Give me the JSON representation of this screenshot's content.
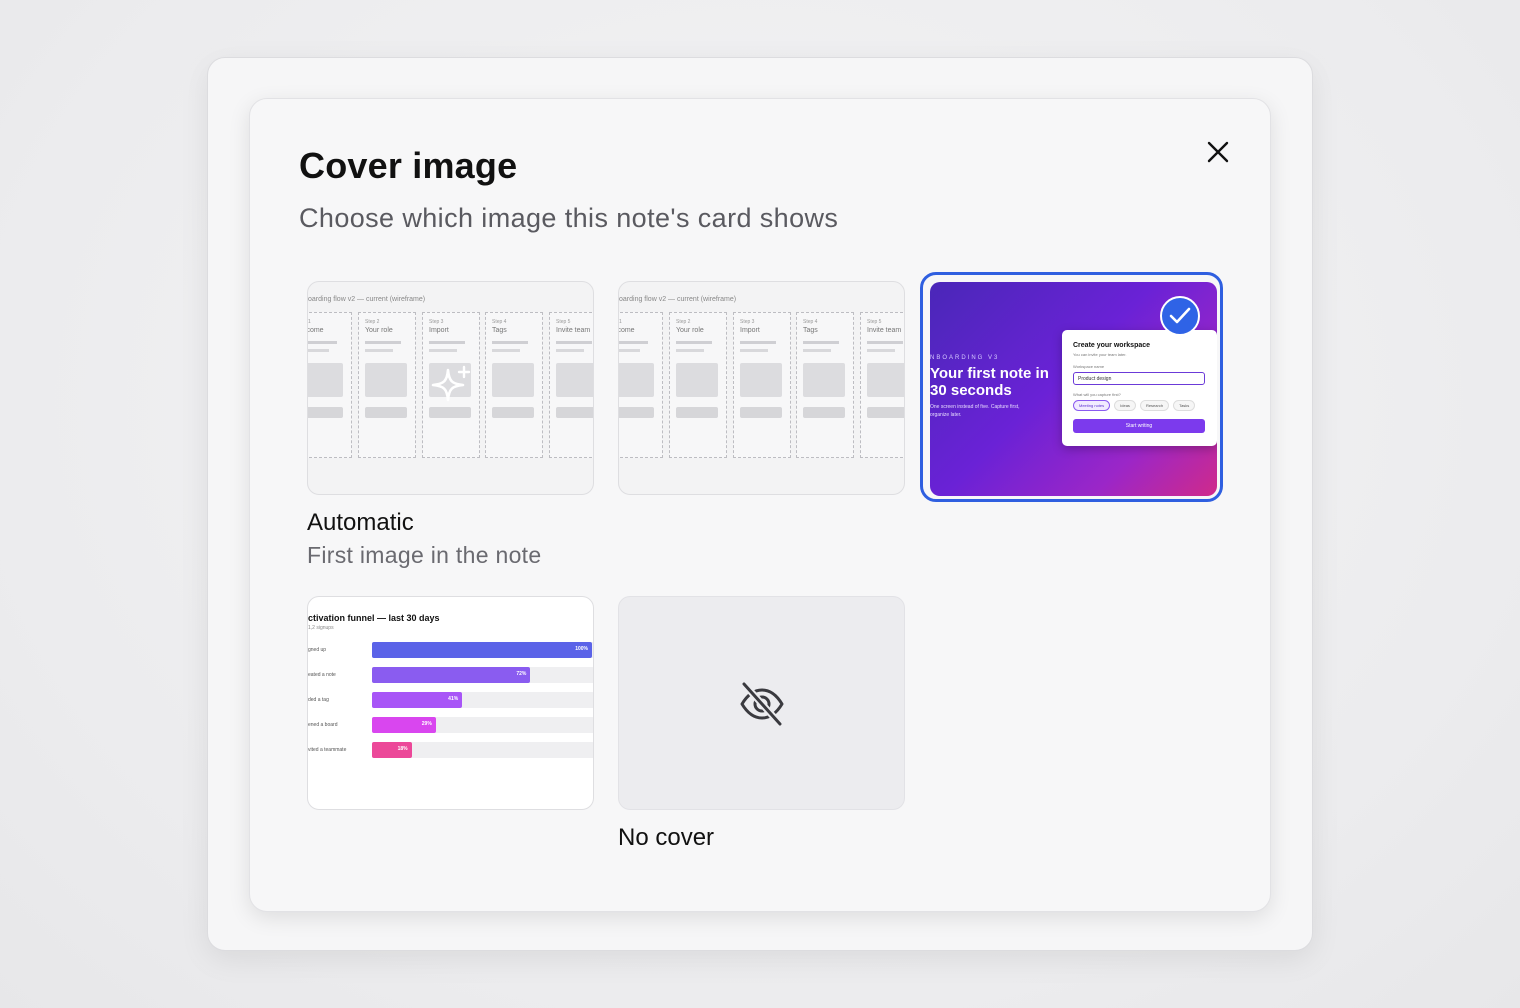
{
  "dialog": {
    "title": "Cover image",
    "subtitle": "Choose which image this note's card shows",
    "close_icon": "close-icon"
  },
  "options": [
    {
      "label": "Automatic",
      "sublabel": "First image in the note",
      "selected": false,
      "icon": "sparkle-icon"
    },
    {
      "label": "",
      "sublabel": "",
      "selected": false
    },
    {
      "label": "",
      "sublabel": "",
      "selected": true,
      "icon": "check-icon"
    },
    {
      "label": "",
      "sublabel": "",
      "selected": false
    },
    {
      "label": "No cover",
      "sublabel": "",
      "selected": false,
      "icon": "eye-off-icon"
    }
  ],
  "wireframe": {
    "title": "oarding flow v2 — current (wireframe)",
    "steps": [
      {
        "step": "ep 1",
        "name": "elcome"
      },
      {
        "step": "Step 2",
        "name": "Your role"
      },
      {
        "step": "Step 3",
        "name": "Import"
      },
      {
        "step": "Step 4",
        "name": "Tags"
      },
      {
        "step": "Step 5",
        "name": "Invite team"
      }
    ]
  },
  "preview": {
    "eyebrow": "NBOARDING V3",
    "headline": "Your first note in 30 seconds",
    "body": "One screen instead of five. Capture first, organize later.",
    "modal_title": "Create your workspace",
    "modal_sub": "You can invite your team later.",
    "field_label": "Workspace name",
    "field_value": "Product design",
    "question": "What will you capture first?",
    "chips": [
      "Meeting notes",
      "Ideas",
      "Research",
      "Tasks"
    ],
    "button": "Start writing",
    "accent": "#7c3aed",
    "check_color": "#2f63e6"
  },
  "funnel": {
    "title": "ctivation funnel — last 30 days",
    "subtitle": "1,2 signups",
    "rows": [
      {
        "label": "gned up",
        "pct": "100%",
        "value": 100,
        "color": "#5b63e8"
      },
      {
        "label": "eated a note",
        "pct": "72%",
        "value": 72,
        "color": "#8a5cf0"
      },
      {
        "label": "ded a tag",
        "pct": "41%",
        "value": 41,
        "color": "#a855f7"
      },
      {
        "label": "ened a board",
        "pct": "29%",
        "value": 29,
        "color": "#d946ef"
      },
      {
        "label": "vited a teammate",
        "pct": "18%",
        "value": 18,
        "color": "#ec4899"
      }
    ]
  }
}
